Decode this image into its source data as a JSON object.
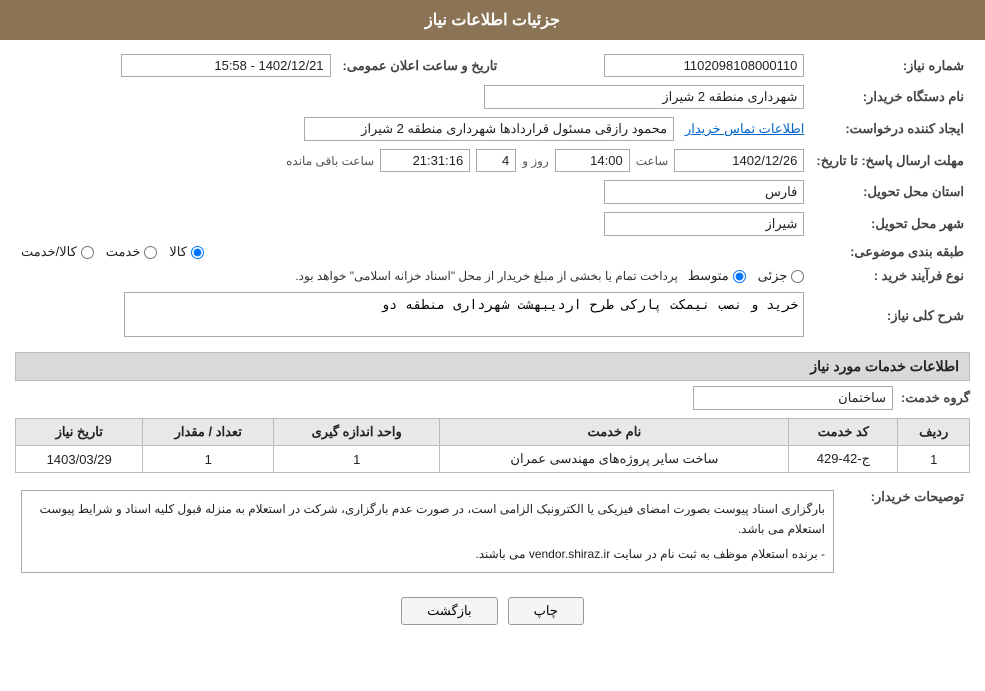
{
  "header": {
    "title": "جزئیات اطلاعات نیاز"
  },
  "fields": {
    "shomareNiaz_label": "شماره نیاز:",
    "shomareNiaz_value": "1102098108000110",
    "namDastgah_label": "نام دستگاه خریدار:",
    "namDastgah_value": "شهرداری منطقه 2 شیراز",
    "ijadKonande_label": "ایجاد کننده درخواست:",
    "ijadKonande_value": "محمود رازقی مسئول قراردادها شهرداری منطقه 2 شیراز",
    "ijadKonande_link": "اطلاعات تماس خریدار",
    "mohlat_label": "مهلت ارسال پاسخ: تا تاریخ:",
    "mohlat_date": "1402/12/26",
    "mohlat_saat_label": "ساعت",
    "mohlat_saat": "14:00",
    "mohlat_roz_label": "روز و",
    "mohlat_roz": "4",
    "mohlat_baqi_label": "ساعت باقی مانده",
    "mohlat_baqi": "21:31:16",
    "ostanTahvil_label": "استان محل تحویل:",
    "ostanTahvil_value": "فارس",
    "shahrTahvil_label": "شهر محل تحویل:",
    "shahrTahvil_value": "شیراز",
    "tarifBandi_label": "طبقه بندی موضوعی:",
    "tarifBandi_options": [
      "کالا",
      "خدمت",
      "کالا/خدمت"
    ],
    "tarifBandi_selected": "کالا",
    "noFarayand_label": "نوع فرآیند خرید :",
    "noFarayand_options": [
      "جزئی",
      "متوسط"
    ],
    "noFarayand_selected": "متوسط",
    "noFarayand_note": "پرداخت تمام یا بخشی از مبلغ خریدار از محل \"اسناد خزانه اسلامی\" خواهد بود.",
    "sharhKoli_label": "شرح کلی نیاز:",
    "sharhKoli_value": "خرید و نصب نیمکت پارکی طرح اردیبهشت شهرداری منطقه دو",
    "servicesSection_label": "اطلاعات خدمات مورد نیاز",
    "groupKhadamat_label": "گروه خدمت:",
    "groupKhadamat_value": "ساختمان",
    "table": {
      "headers": [
        "ردیف",
        "کد خدمت",
        "نام خدمت",
        "واحد اندازه گیری",
        "تعداد / مقدار",
        "تاریخ نیاز"
      ],
      "rows": [
        {
          "radif": "1",
          "kodKhadamat": "ج-42-429",
          "namKhadamat": "ساخت سایر پروژه‌های مهندسی عمران",
          "vahed": "1",
          "tedad": "1",
          "tarikh": "1403/03/29"
        }
      ]
    },
    "tosif_label": "توصیحات خریدار:",
    "tosif_value_line1": "بارگزاری اسناد پیوست بصورت امضای فیزیکی یا الکترونیک الزامی است، در صورت عدم بارگزاری، شرکت در استعلام به منزله قبول کلیه اسناد و شرایط پیوست استعلام می باشد.",
    "tosif_value_line2": "- برنده استعلام موظف به ثبت نام در سایت vendor.shiraz.ir می باشند.",
    "btn_bazgasht": "بازگشت",
    "btn_chap": "چاپ",
    "tarikheElam_label": "تاریخ و ساعت اعلان عمومی:",
    "tarikheElam_value": "1402/12/21 - 15:58"
  }
}
